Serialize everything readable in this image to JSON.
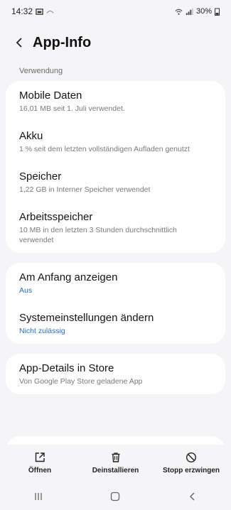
{
  "status_bar": {
    "time": "14:32",
    "battery": "30%"
  },
  "header": {
    "title": "App-Info"
  },
  "usage": {
    "section_label": "Verwendung",
    "rows": [
      {
        "title": "Mobile Daten",
        "sub": "16,01 MB seit 1. Juli verwendet."
      },
      {
        "title": "Akku",
        "sub": "1 % seit dem letzten vollständigen Aufladen genutzt"
      },
      {
        "title": "Speicher",
        "sub": "1,22 GB in Interner Speicher verwendet"
      },
      {
        "title": "Arbeitsspeicher",
        "sub": "10 MB in den letzten 3 Stunden durchschnittlich verwendet"
      }
    ]
  },
  "settings": {
    "rows": [
      {
        "title": "Am Anfang anzeigen",
        "sub": "Aus"
      },
      {
        "title": "Systemeinstellungen ändern",
        "sub": "Nicht zulässig"
      }
    ]
  },
  "store": {
    "title": "App-Details in Store",
    "sub": "Von Google Play Store geladene App"
  },
  "actions": {
    "open": "Öffnen",
    "uninstall": "Deinstallieren",
    "force_stop": "Stopp erzwingen"
  },
  "colors": {
    "link": "#2b6fb8",
    "background": "#f5f5f7",
    "card": "#ffffff"
  }
}
